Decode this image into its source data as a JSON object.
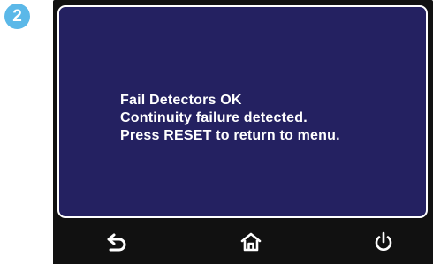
{
  "step_badge": "2",
  "screen": {
    "lines": [
      "Fail Detectors OK",
      "Continuity failure detected.",
      "Press RESET to return to menu."
    ]
  },
  "navbar": {
    "back_icon": "back-arrow-icon",
    "home_icon": "home-icon",
    "power_icon": "power-icon"
  },
  "colors": {
    "screen_background": "#242161",
    "bezel": "#111111",
    "text": "#ffffff",
    "badge": "#5bb8e8"
  }
}
